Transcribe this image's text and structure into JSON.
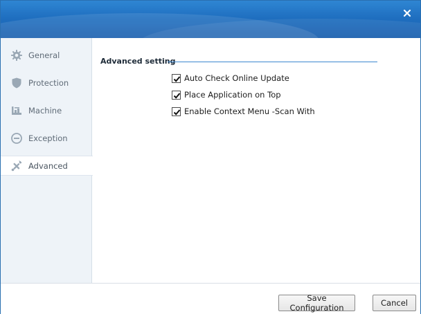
{
  "window": {
    "close_icon": "close-icon",
    "accent_color": "#1f6fc0"
  },
  "sidebar": {
    "items": [
      {
        "label": "General",
        "icon": "gear-icon",
        "active": false
      },
      {
        "label": "Protection",
        "icon": "shield-icon",
        "active": false
      },
      {
        "label": "Machine",
        "icon": "machine-icon",
        "active": false
      },
      {
        "label": "Exception",
        "icon": "minus-circle-icon",
        "active": false
      },
      {
        "label": "Advanced",
        "icon": "tools-icon",
        "active": true
      }
    ]
  },
  "main": {
    "section_title": "Advanced setting",
    "options": [
      {
        "label": "Auto Check Online Update",
        "checked": true
      },
      {
        "label": "Place Application on Top",
        "checked": true
      },
      {
        "label": "Enable Context Menu -Scan With",
        "checked": true
      }
    ]
  },
  "footer": {
    "save_label": "Save Configuration",
    "cancel_label": "Cancel"
  }
}
